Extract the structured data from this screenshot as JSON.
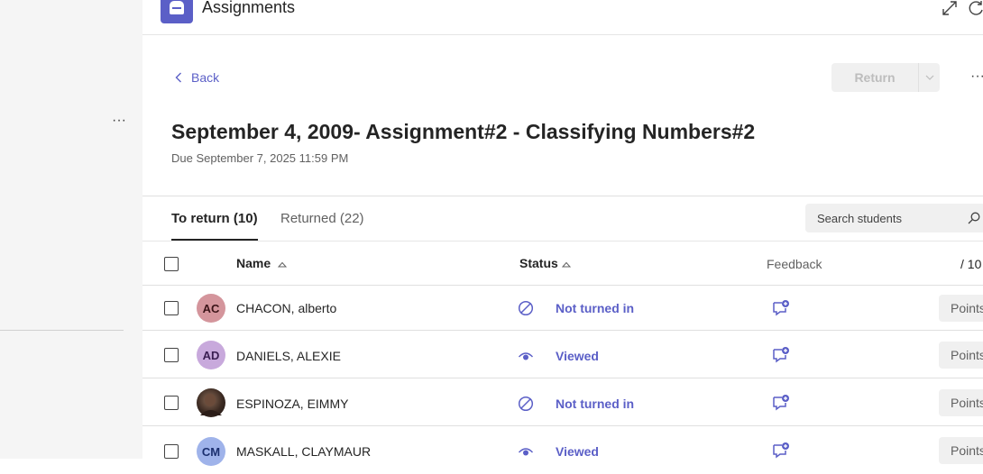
{
  "app": {
    "title": "Assignments"
  },
  "nav": {
    "back_label": "Back",
    "return_label": "Return"
  },
  "assignment": {
    "title": "September 4, 2009- Assignment#2 - Classifying Numbers#2",
    "due": "Due September 7, 2025 11:59 PM"
  },
  "tabs": [
    {
      "label": "To return (10)"
    },
    {
      "label": "Returned (22)"
    }
  ],
  "search": {
    "placeholder": "Search students"
  },
  "table": {
    "headers": {
      "name": "Name",
      "status": "Status",
      "feedback": "Feedback",
      "points": "/ 10"
    },
    "rows": [
      {
        "initials": "AC",
        "name": "CHACON, alberto",
        "status": "Not turned in",
        "status_icon": "not-turned-in-icon",
        "avatar_bg": "#d4959c",
        "avatar_fg": "#3b1418",
        "points_placeholder": "Points"
      },
      {
        "initials": "AD",
        "name": "DANIELS, ALEXIE",
        "status": "Viewed",
        "status_icon": "eye-icon",
        "avatar_bg": "#c8a9dc",
        "avatar_fg": "#3a1e52",
        "points_placeholder": "Points"
      },
      {
        "initials": "",
        "name": "ESPINOZA, EIMMY",
        "status": "Not turned in",
        "status_icon": "not-turned-in-icon",
        "avatar_bg": "#3b2a22",
        "avatar_fg": "#ffffff",
        "points_placeholder": "Points"
      },
      {
        "initials": "CM",
        "name": "MASKALL, CLAYMAUR",
        "status": "Viewed",
        "status_icon": "eye-icon",
        "avatar_bg": "#9fb3ea",
        "avatar_fg": "#1b2f6e",
        "points_placeholder": "Points"
      }
    ]
  },
  "colors": {
    "accent": "#5b5fc7",
    "left_pane": "#f5f5f5"
  }
}
